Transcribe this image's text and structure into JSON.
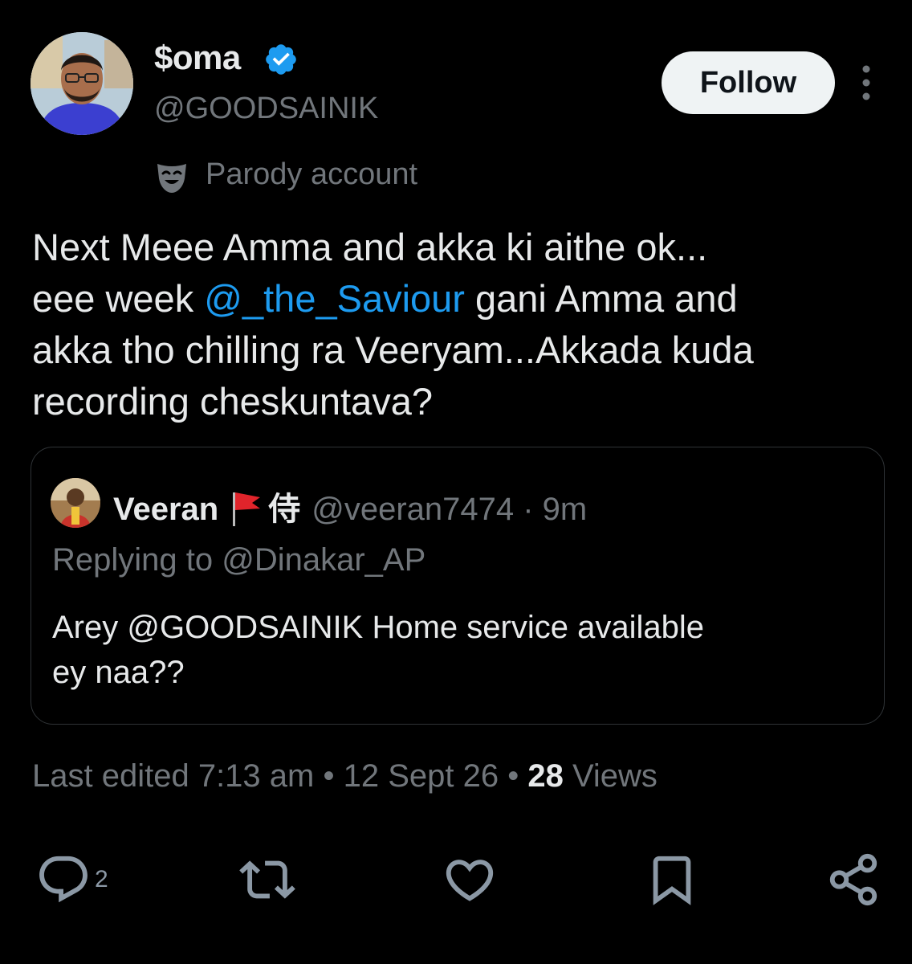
{
  "author": {
    "display_name": "$oma",
    "handle": "@GOODSAINIK",
    "verified_icon": "verified-badge-icon",
    "label": "Parody account",
    "label_icon": "parody-mask-icon"
  },
  "header": {
    "follow_label": "Follow",
    "more_icon": "more-vertical-icon"
  },
  "tweet": {
    "line1": "Next Meee Amma and akka ki aithe ok...",
    "line2_pre": "eee week ",
    "line2_mention": "@_the_Saviour",
    "line2_post": " gani Amma and",
    "line3": "akka tho chilling ra Veeryam...Akkada kuda",
    "line4": "recording cheskuntava?"
  },
  "quote": {
    "name": "Veeran",
    "glyph": "侍",
    "handle": "@veeran7474",
    "time": "· 9m",
    "replying_to": "Replying to @Dinakar_AP",
    "text_line1": "Arey @GOODSAINIK Home service available",
    "text_line2": "ey naa??"
  },
  "meta": {
    "edited": "Last edited 7:13 am",
    "sep1": " • ",
    "date": "12 Sept 26",
    "sep2": " • ",
    "views_count": "28",
    "views_label": " Views"
  },
  "actions": {
    "reply_count": "2",
    "icons": [
      "reply-icon",
      "retweet-icon",
      "like-icon",
      "bookmark-icon",
      "share-icon"
    ]
  },
  "colors": {
    "background": "#000000",
    "text": "#e7e9ea",
    "secondary": "#71767b",
    "accent": "#1d9bf0"
  }
}
